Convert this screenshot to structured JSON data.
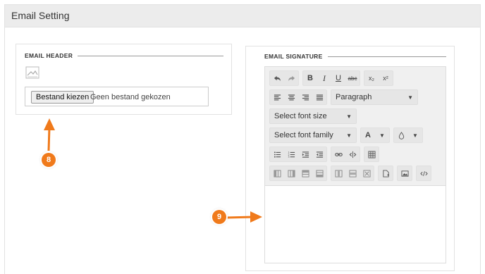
{
  "page": {
    "title": "Email Setting"
  },
  "email_header": {
    "legend": "EMAIL HEADER",
    "image_icon": "image-placeholder-icon",
    "file_button": "Bestand kiezen",
    "file_status": "Geen bestand gekozen"
  },
  "email_signature": {
    "legend": "EMAIL SIGNATURE",
    "toolbar": {
      "bold": "B",
      "italic": "I",
      "underline": "U",
      "strike": "abc",
      "subscript": "x₂",
      "superscript": "x²",
      "format_select": "Paragraph",
      "font_size_select": "Select font size",
      "font_family_select": "Select font family",
      "text_color": "A"
    }
  },
  "callouts": {
    "one": "8",
    "two": "9"
  },
  "colors": {
    "accent": "#f07a1b"
  }
}
